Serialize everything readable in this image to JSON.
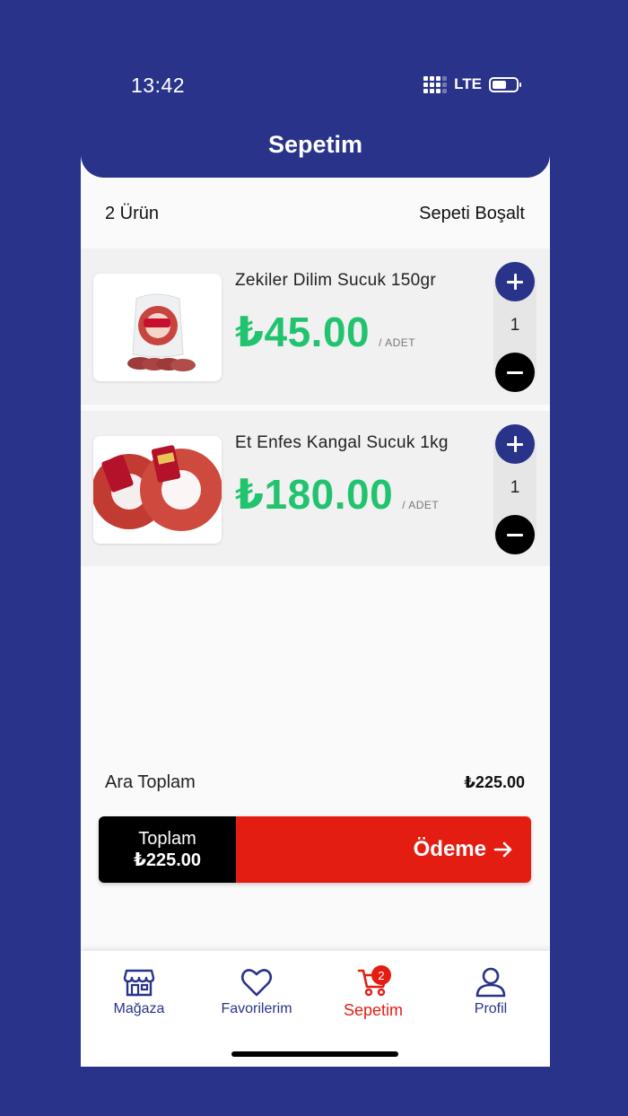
{
  "status": {
    "time": "13:42",
    "network": "LTE"
  },
  "header": {
    "title": "Sepetim"
  },
  "summary": {
    "count_label": "2 Ürün",
    "clear_label": "Sepeti Boşalt"
  },
  "items": [
    {
      "name": "Zekiler Dilim Sucuk 150gr",
      "price": "₺45.00",
      "unit": "/ ADET",
      "qty": "1"
    },
    {
      "name": "Et Enfes Kangal Sucuk 1kg",
      "price": "₺180.00",
      "unit": "/ ADET",
      "qty": "1"
    }
  ],
  "subtotal": {
    "label": "Ara Toplam",
    "value": "₺225.00"
  },
  "checkout": {
    "total_label": "Toplam",
    "total_value": "₺225.00",
    "pay_label": "Ödeme"
  },
  "tabs": [
    {
      "label": "Mağaza",
      "icon": "store-icon"
    },
    {
      "label": "Favorilerim",
      "icon": "heart-icon"
    },
    {
      "label": "Sepetim",
      "icon": "cart-icon",
      "badge": "2"
    },
    {
      "label": "Profil",
      "icon": "user-icon"
    }
  ],
  "colors": {
    "brand": "#283389",
    "price": "#22c36f",
    "accent": "#e41d13"
  }
}
